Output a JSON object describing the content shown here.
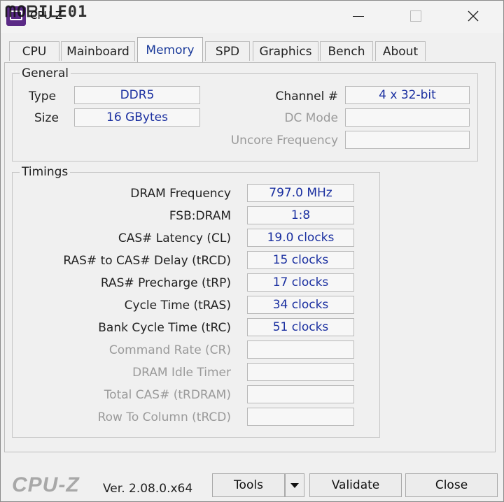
{
  "window": {
    "title": "CPU-Z",
    "watermark": "ᗰOᗷIᒪE01"
  },
  "tabs": [
    {
      "label": "CPU"
    },
    {
      "label": "Mainboard"
    },
    {
      "label": "Memory"
    },
    {
      "label": "SPD"
    },
    {
      "label": "Graphics"
    },
    {
      "label": "Bench"
    },
    {
      "label": "About"
    }
  ],
  "active_tab": "Memory",
  "general": {
    "title": "General",
    "type_label": "Type",
    "type_value": "DDR5",
    "size_label": "Size",
    "size_value": "16 GBytes",
    "channel_label": "Channel #",
    "channel_value": "4 x 32-bit",
    "dc_mode_label": "DC Mode",
    "dc_mode_value": "",
    "uncore_label": "Uncore Frequency",
    "uncore_value": ""
  },
  "timings": {
    "title": "Timings",
    "rows": [
      {
        "label": "DRAM Frequency",
        "value": "797.0 MHz",
        "disabled": false
      },
      {
        "label": "FSB:DRAM",
        "value": "1:8",
        "disabled": false
      },
      {
        "label": "CAS# Latency (CL)",
        "value": "19.0 clocks",
        "disabled": false
      },
      {
        "label": "RAS# to CAS# Delay (tRCD)",
        "value": "15 clocks",
        "disabled": false
      },
      {
        "label": "RAS# Precharge (tRP)",
        "value": "17 clocks",
        "disabled": false
      },
      {
        "label": "Cycle Time (tRAS)",
        "value": "34 clocks",
        "disabled": false
      },
      {
        "label": "Bank Cycle Time (tRC)",
        "value": "51 clocks",
        "disabled": false
      },
      {
        "label": "Command Rate (CR)",
        "value": "",
        "disabled": true
      },
      {
        "label": "DRAM Idle Timer",
        "value": "",
        "disabled": true
      },
      {
        "label": "Total CAS# (tRDRAM)",
        "value": "",
        "disabled": true
      },
      {
        "label": "Row To Column (tRCD)",
        "value": "",
        "disabled": true
      }
    ]
  },
  "footer": {
    "logo": "CPU-Z",
    "version": "Ver. 2.08.0.x64",
    "tools_label": "Tools",
    "validate_label": "Validate",
    "close_label": "Close"
  }
}
